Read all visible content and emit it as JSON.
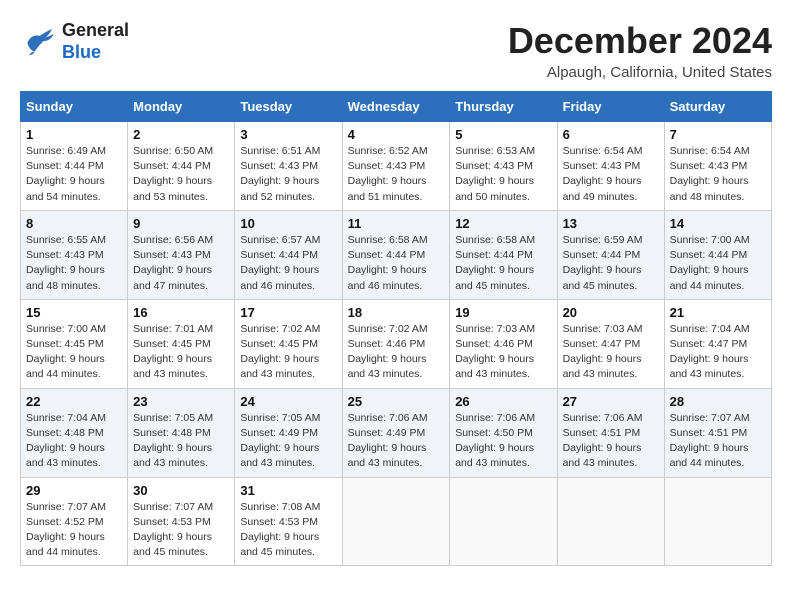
{
  "logo": {
    "line1": "General",
    "line2": "Blue"
  },
  "title": "December 2024",
  "location": "Alpaugh, California, United States",
  "days_of_week": [
    "Sunday",
    "Monday",
    "Tuesday",
    "Wednesday",
    "Thursday",
    "Friday",
    "Saturday"
  ],
  "weeks": [
    [
      {
        "day": "1",
        "sunrise": "6:49 AM",
        "sunset": "4:44 PM",
        "daylight": "9 hours and 54 minutes."
      },
      {
        "day": "2",
        "sunrise": "6:50 AM",
        "sunset": "4:44 PM",
        "daylight": "9 hours and 53 minutes."
      },
      {
        "day": "3",
        "sunrise": "6:51 AM",
        "sunset": "4:43 PM",
        "daylight": "9 hours and 52 minutes."
      },
      {
        "day": "4",
        "sunrise": "6:52 AM",
        "sunset": "4:43 PM",
        "daylight": "9 hours and 51 minutes."
      },
      {
        "day": "5",
        "sunrise": "6:53 AM",
        "sunset": "4:43 PM",
        "daylight": "9 hours and 50 minutes."
      },
      {
        "day": "6",
        "sunrise": "6:54 AM",
        "sunset": "4:43 PM",
        "daylight": "9 hours and 49 minutes."
      },
      {
        "day": "7",
        "sunrise": "6:54 AM",
        "sunset": "4:43 PM",
        "daylight": "9 hours and 48 minutes."
      }
    ],
    [
      {
        "day": "8",
        "sunrise": "6:55 AM",
        "sunset": "4:43 PM",
        "daylight": "9 hours and 48 minutes."
      },
      {
        "day": "9",
        "sunrise": "6:56 AM",
        "sunset": "4:43 PM",
        "daylight": "9 hours and 47 minutes."
      },
      {
        "day": "10",
        "sunrise": "6:57 AM",
        "sunset": "4:44 PM",
        "daylight": "9 hours and 46 minutes."
      },
      {
        "day": "11",
        "sunrise": "6:58 AM",
        "sunset": "4:44 PM",
        "daylight": "9 hours and 46 minutes."
      },
      {
        "day": "12",
        "sunrise": "6:58 AM",
        "sunset": "4:44 PM",
        "daylight": "9 hours and 45 minutes."
      },
      {
        "day": "13",
        "sunrise": "6:59 AM",
        "sunset": "4:44 PM",
        "daylight": "9 hours and 45 minutes."
      },
      {
        "day": "14",
        "sunrise": "7:00 AM",
        "sunset": "4:44 PM",
        "daylight": "9 hours and 44 minutes."
      }
    ],
    [
      {
        "day": "15",
        "sunrise": "7:00 AM",
        "sunset": "4:45 PM",
        "daylight": "9 hours and 44 minutes."
      },
      {
        "day": "16",
        "sunrise": "7:01 AM",
        "sunset": "4:45 PM",
        "daylight": "9 hours and 43 minutes."
      },
      {
        "day": "17",
        "sunrise": "7:02 AM",
        "sunset": "4:45 PM",
        "daylight": "9 hours and 43 minutes."
      },
      {
        "day": "18",
        "sunrise": "7:02 AM",
        "sunset": "4:46 PM",
        "daylight": "9 hours and 43 minutes."
      },
      {
        "day": "19",
        "sunrise": "7:03 AM",
        "sunset": "4:46 PM",
        "daylight": "9 hours and 43 minutes."
      },
      {
        "day": "20",
        "sunrise": "7:03 AM",
        "sunset": "4:47 PM",
        "daylight": "9 hours and 43 minutes."
      },
      {
        "day": "21",
        "sunrise": "7:04 AM",
        "sunset": "4:47 PM",
        "daylight": "9 hours and 43 minutes."
      }
    ],
    [
      {
        "day": "22",
        "sunrise": "7:04 AM",
        "sunset": "4:48 PM",
        "daylight": "9 hours and 43 minutes."
      },
      {
        "day": "23",
        "sunrise": "7:05 AM",
        "sunset": "4:48 PM",
        "daylight": "9 hours and 43 minutes."
      },
      {
        "day": "24",
        "sunrise": "7:05 AM",
        "sunset": "4:49 PM",
        "daylight": "9 hours and 43 minutes."
      },
      {
        "day": "25",
        "sunrise": "7:06 AM",
        "sunset": "4:49 PM",
        "daylight": "9 hours and 43 minutes."
      },
      {
        "day": "26",
        "sunrise": "7:06 AM",
        "sunset": "4:50 PM",
        "daylight": "9 hours and 43 minutes."
      },
      {
        "day": "27",
        "sunrise": "7:06 AM",
        "sunset": "4:51 PM",
        "daylight": "9 hours and 43 minutes."
      },
      {
        "day": "28",
        "sunrise": "7:07 AM",
        "sunset": "4:51 PM",
        "daylight": "9 hours and 44 minutes."
      }
    ],
    [
      {
        "day": "29",
        "sunrise": "7:07 AM",
        "sunset": "4:52 PM",
        "daylight": "9 hours and 44 minutes."
      },
      {
        "day": "30",
        "sunrise": "7:07 AM",
        "sunset": "4:53 PM",
        "daylight": "9 hours and 45 minutes."
      },
      {
        "day": "31",
        "sunrise": "7:08 AM",
        "sunset": "4:53 PM",
        "daylight": "9 hours and 45 minutes."
      },
      null,
      null,
      null,
      null
    ]
  ],
  "labels": {
    "sunrise": "Sunrise:",
    "sunset": "Sunset:",
    "daylight": "Daylight:"
  }
}
